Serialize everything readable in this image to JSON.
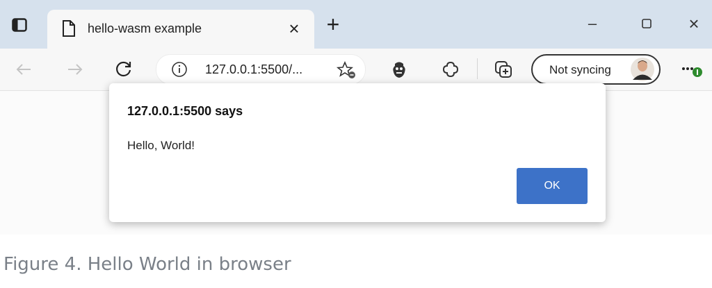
{
  "window": {
    "tab_title": "hello-wasm example",
    "tab_close": "×",
    "new_tab": "+",
    "controls": {
      "minimize": "–",
      "close": "×"
    }
  },
  "toolbar": {
    "url": "127.0.0.1:5500/...",
    "sync_label": "Not syncing",
    "icons": [
      "back-icon",
      "forward-icon",
      "refresh-icon",
      "info-icon",
      "favorite-icon",
      "extension-icon",
      "performance-icon",
      "collections-icon",
      "more-icon"
    ]
  },
  "dialog": {
    "title": "127.0.0.1:5500 says",
    "message": "Hello, World!",
    "ok_label": "OK"
  },
  "caption": "Figure 4. Hello World in browser",
  "colors": {
    "titlebar": "#d6e1ed",
    "ok_button": "#3d72c8",
    "caption": "#7a8088"
  }
}
